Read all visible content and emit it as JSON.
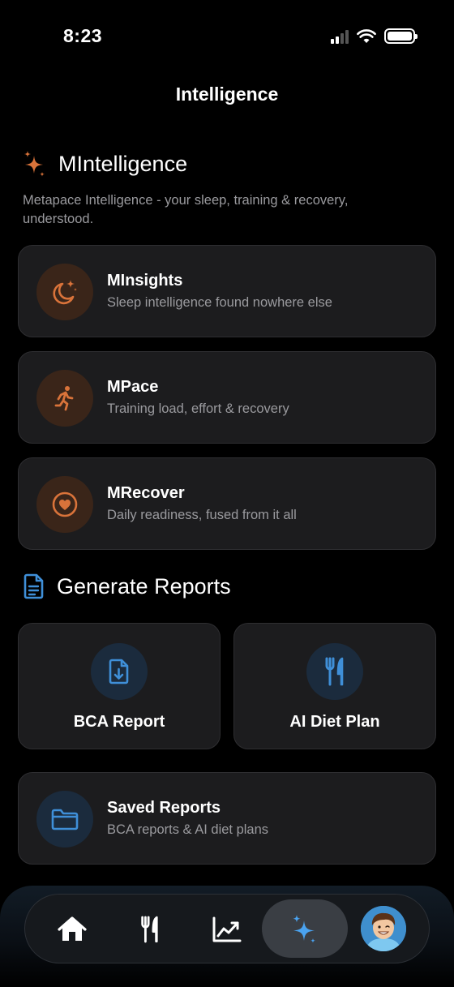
{
  "status_bar": {
    "time": "8:23"
  },
  "nav": {
    "title": "Intelligence"
  },
  "intelligence": {
    "title": "MIntelligence",
    "description": "Metapace Intelligence - your sleep, training & recovery, understood.",
    "accent_color": "#d9733a",
    "items": [
      {
        "title": "MInsights",
        "subtitle": "Sleep intelligence found nowhere else",
        "icon": "moon-stars-icon"
      },
      {
        "title": "MPace",
        "subtitle": "Training load, effort & recovery",
        "icon": "runner-icon"
      },
      {
        "title": "MRecover",
        "subtitle": "Daily readiness, fused from it all",
        "icon": "heart-circle-icon"
      }
    ]
  },
  "reports": {
    "title": "Generate Reports",
    "accent_color": "#3f8fd8",
    "tiles": [
      {
        "label": "BCA Report",
        "icon": "document-download-icon"
      },
      {
        "label": "AI Diet Plan",
        "icon": "fork-knife-icon"
      }
    ],
    "saved": {
      "title": "Saved Reports",
      "subtitle": "BCA reports & AI diet plans",
      "icon": "folder-icon"
    }
  },
  "tabbar": {
    "items": [
      {
        "name": "home",
        "icon": "home-icon"
      },
      {
        "name": "nutrition",
        "icon": "fork-knife-icon"
      },
      {
        "name": "progress",
        "icon": "chart-icon"
      },
      {
        "name": "intelligence",
        "icon": "sparkles-icon",
        "active": true
      },
      {
        "name": "profile",
        "icon": "avatar"
      }
    ]
  }
}
